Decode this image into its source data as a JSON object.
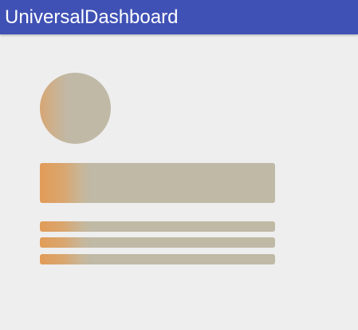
{
  "app": {
    "title": "UniversalDashboard"
  },
  "theme": {
    "app_bar_color": "#3f51b5",
    "background_color": "#eeeeee",
    "skeleton_color": "#bfb9a6",
    "shimmer_color": "#e29c57"
  },
  "skeleton": {
    "line_count": 3
  }
}
